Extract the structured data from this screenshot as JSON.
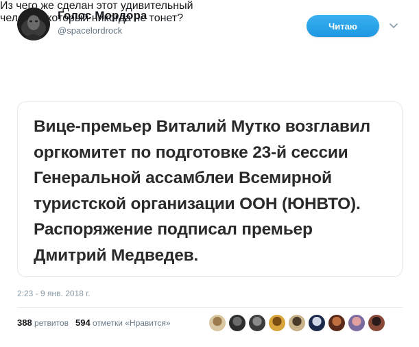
{
  "author": {
    "name": "Голос Мордора",
    "handle": "@spacelordrock"
  },
  "follow_button": {
    "label": "Читаю"
  },
  "tweet": {
    "text_lines": [
      "Из чего же сделан этот удивительный",
      "человек, который никогда не тонет?"
    ]
  },
  "media": {
    "text_lines": [
      "Вице-премьер Виталий Мутко возглавил",
      "оргкомитет по подготовке 23-й сессии",
      "Генеральной ассамблеи Всемирной",
      "туристской организации ООН (ЮНВТО).",
      "Распоряжение подписал премьер",
      "Дмитрий Медведев."
    ]
  },
  "timestamp": "2:23 - 9 янв. 2018 г.",
  "stats": {
    "retweets_count": "388",
    "retweets_label": "ретвитов",
    "likes_count": "594",
    "likes_label": "отметки «Нравится»"
  },
  "icons": {
    "caret": "chevron-down-icon"
  },
  "colors": {
    "accent": "#1da1f2",
    "text": "#14171a",
    "secondary": "#657786"
  },
  "likers": [
    {
      "name": "liker-avatar",
      "colors": [
        "#d8c7a0",
        "#9c7b4d"
      ]
    },
    {
      "name": "liker-avatar",
      "colors": [
        "#2d2d2d",
        "#6a6a6a"
      ]
    },
    {
      "name": "liker-avatar",
      "colors": [
        "#3b3b3b",
        "#8a8a8a"
      ]
    },
    {
      "name": "liker-avatar",
      "colors": [
        "#d9a43a",
        "#7a4e12"
      ]
    },
    {
      "name": "liker-avatar",
      "colors": [
        "#c9b28a",
        "#4a3a2a"
      ]
    },
    {
      "name": "liker-avatar",
      "colors": [
        "#1b2a4a",
        "#d0d8e8"
      ]
    },
    {
      "name": "liker-avatar",
      "colors": [
        "#5a2a1a",
        "#c07040"
      ]
    },
    {
      "name": "liker-avatar",
      "colors": [
        "#7a6aa0",
        "#e0a0a0"
      ]
    },
    {
      "name": "liker-avatar",
      "colors": [
        "#8a4a3a",
        "#2a1a1a"
      ]
    }
  ]
}
